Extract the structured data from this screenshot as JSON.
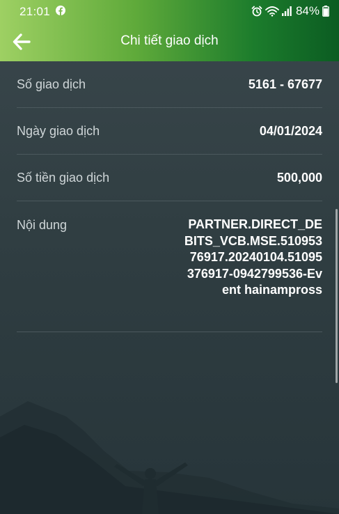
{
  "status_bar": {
    "time": "21:01",
    "app_notification_icon": "facebook-icon",
    "alarm_icon": "alarm-icon",
    "wifi_icon": "wifi-icon",
    "signal_icon": "signal-icon",
    "battery_percent": "84%",
    "battery_level": 0.84
  },
  "header": {
    "back_icon": "arrow-left-icon",
    "title": "Chi tiết giao dịch"
  },
  "details": {
    "transaction_number": {
      "label": "Số giao dịch",
      "value": "5161 - 67677"
    },
    "transaction_date": {
      "label": "Ngày giao dịch",
      "value": "04/01/2024"
    },
    "amount": {
      "label": "Số tiền giao dịch",
      "value": "500,000"
    },
    "content": {
      "label": "Nội dung",
      "value": "PARTNER.DIRECT_DEBITS_VCB.MSE.51095376917.20240104.51095376917-0942799536-Event hainampross"
    }
  },
  "colors": {
    "header_gradient_start": "#9ed063",
    "header_gradient_end": "#0b5c22",
    "background": "#303e42",
    "divider": "#4c595e",
    "label_text": "#cfd6d8",
    "value_text": "#ffffff"
  }
}
